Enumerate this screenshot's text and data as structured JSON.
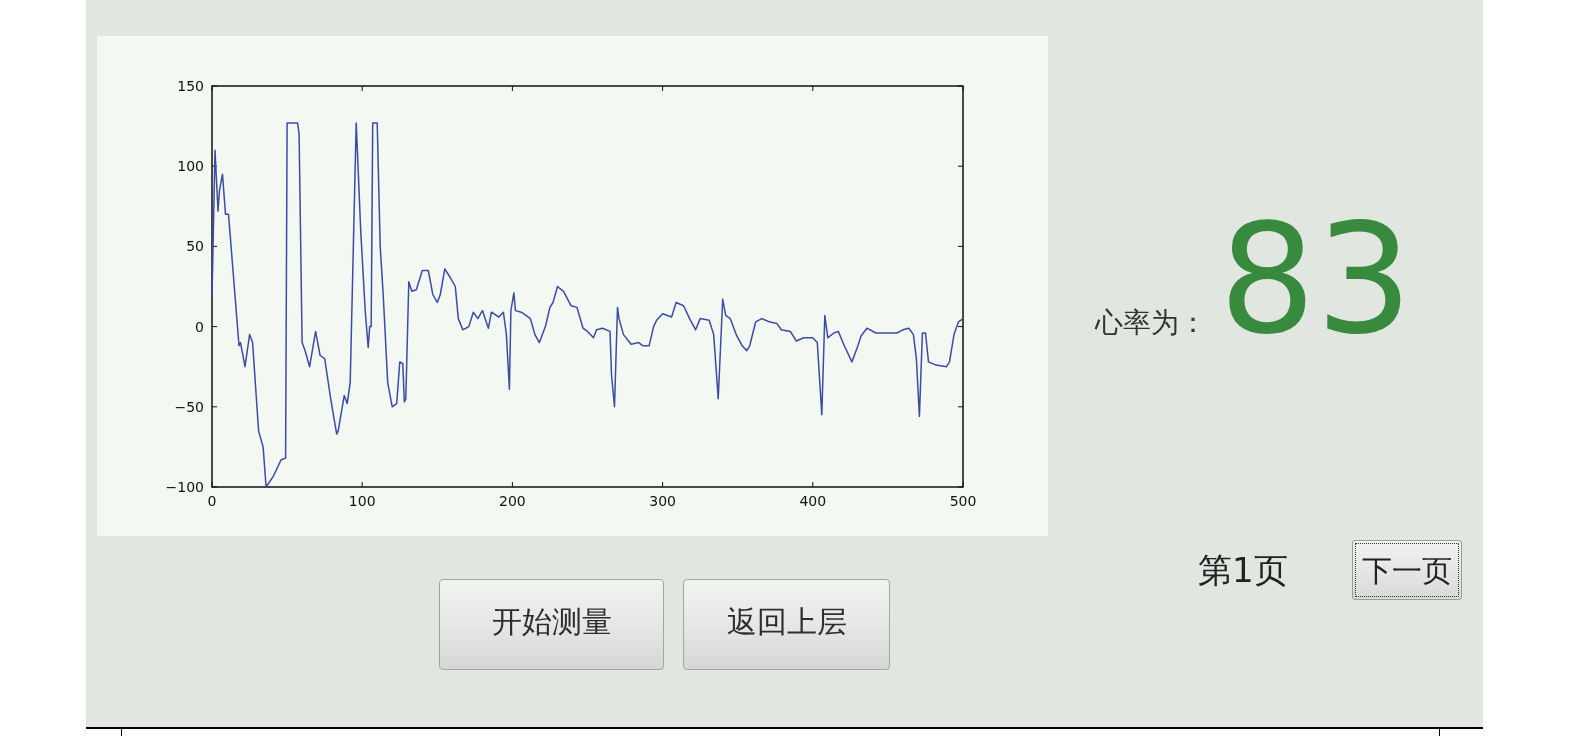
{
  "chart": {
    "chart_data": {
      "type": "line",
      "xlim": [
        0,
        500
      ],
      "ylim": [
        -100,
        150
      ],
      "xticks": [
        0,
        100,
        200,
        300,
        400,
        500
      ],
      "yticks": [
        {
          "value": -100,
          "label": "−100"
        },
        {
          "value": -50,
          "label": "−50"
        },
        0,
        50,
        100,
        150
      ],
      "x": [
        0,
        2,
        4,
        5,
        7,
        9,
        11,
        14,
        18,
        19,
        22,
        25,
        27,
        31,
        34,
        36,
        41,
        46,
        49,
        50,
        57,
        58,
        60,
        62,
        65,
        69,
        72,
        75,
        79,
        83,
        84,
        88,
        90,
        92,
        96,
        99,
        102,
        104,
        105,
        106,
        107,
        110,
        112,
        114,
        117,
        120,
        123,
        125,
        127,
        128,
        129,
        131,
        133,
        136,
        140,
        144,
        147,
        150,
        152,
        155,
        159,
        162,
        164,
        167,
        171,
        174,
        177,
        180,
        184,
        186,
        191,
        194,
        196,
        198,
        199,
        201,
        202,
        206,
        212,
        215,
        218,
        222,
        225,
        227,
        230,
        234,
        239,
        243,
        247,
        250,
        254,
        256,
        260,
        265,
        266,
        268,
        270,
        271,
        274,
        279,
        284,
        287,
        291,
        294,
        296,
        300,
        306,
        309,
        314,
        318,
        322,
        325,
        331,
        334,
        337,
        340,
        342,
        345,
        349,
        353,
        356,
        358,
        362,
        366,
        371,
        376,
        379,
        385,
        389,
        394,
        400,
        403,
        406,
        408,
        410,
        414,
        417,
        421,
        426,
        430,
        432,
        436,
        442,
        449,
        456,
        460,
        464,
        467,
        469,
        471,
        473,
        475,
        477,
        482,
        489,
        491,
        494,
        497,
        500
      ],
      "series": [
        {
          "color": "#3b4ca6",
          "values": [
            18,
            110,
            72,
            85,
            95,
            70,
            70,
            35,
            -12,
            -10,
            -25,
            -5,
            -10,
            -65,
            -75,
            -100,
            -93,
            -83,
            -82,
            127,
            127,
            120,
            -10,
            -15,
            -25,
            -3,
            -18,
            -20,
            -45,
            -67,
            -65,
            -43,
            -48,
            -35,
            127,
            60,
            10,
            -13,
            0,
            0,
            127,
            127,
            50,
            20,
            -35,
            -50,
            -48,
            -22,
            -23,
            -47,
            -45,
            28,
            22,
            23,
            35,
            35,
            20,
            15,
            20,
            36,
            30,
            25,
            5,
            -2,
            0,
            9,
            5,
            10,
            -1,
            9,
            6,
            9,
            -5,
            -39,
            10,
            21,
            10,
            9,
            5,
            -5,
            -10,
            0,
            12,
            15,
            25,
            22,
            13,
            12,
            -1,
            -3,
            -7,
            -2,
            -1,
            -3,
            -30,
            -50,
            12,
            5,
            -5,
            -11,
            -10,
            -12,
            -12,
            0,
            4,
            8,
            6,
            15,
            13,
            5,
            -2,
            5,
            4,
            -5,
            -45,
            17,
            7,
            5,
            -5,
            -12,
            -15,
            -12,
            3,
            5,
            3,
            2,
            -2,
            -3,
            -9,
            -7,
            -7,
            -10,
            -55,
            7,
            -7,
            -4,
            -3,
            -12,
            -22,
            -12,
            -6,
            -1,
            -4,
            -4,
            -4,
            -2,
            -1,
            -5,
            -20,
            -56,
            -4,
            -4,
            -22,
            -24,
            -25,
            -22,
            -5,
            3,
            5
          ]
        }
      ]
    }
  },
  "buttons": [
    {
      "label": "开始测量"
    },
    {
      "label": "返回上层"
    }
  ],
  "heart_rate": {
    "label": "心率为：",
    "value": "83"
  },
  "pager": {
    "page_label": "第1页",
    "next_button": {
      "label": "下一页",
      "focused": true
    }
  }
}
